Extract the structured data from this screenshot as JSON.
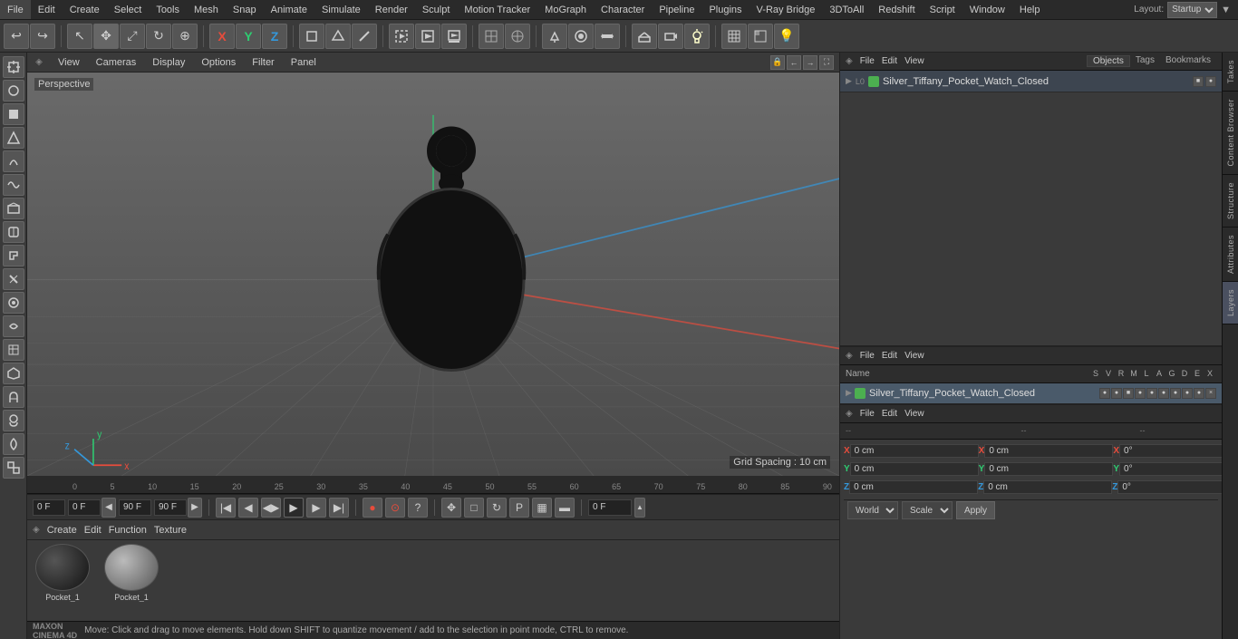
{
  "app": {
    "title": "Cinema 4D",
    "layout": "Startup"
  },
  "menu": {
    "items": [
      "File",
      "Edit",
      "Create",
      "Select",
      "Tools",
      "Mesh",
      "Snap",
      "Animate",
      "Simulate",
      "Render",
      "Sculpt",
      "Motion Tracker",
      "MoGraph",
      "Character",
      "Pipeline",
      "Plugins",
      "V-Ray Bridge",
      "3DToAll",
      "Redshift",
      "Script",
      "Window",
      "Help"
    ]
  },
  "toolbar": {
    "undo_label": "↩",
    "redo_label": "↪"
  },
  "viewport": {
    "label": "Perspective",
    "menu_items": [
      "View",
      "Cameras",
      "Display",
      "Options",
      "Filter",
      "Panel"
    ],
    "grid_spacing": "Grid Spacing : 10 cm"
  },
  "timeline": {
    "start_frame": "0 F",
    "current_frame": "0 F",
    "end_frame": "90 F",
    "max_frame": "90 F",
    "frame_indicator": "0 F",
    "ruler_marks": [
      "0",
      "5",
      "10",
      "15",
      "20",
      "25",
      "30",
      "35",
      "40",
      "45",
      "50",
      "55",
      "60",
      "65",
      "70",
      "75",
      "80",
      "85",
      "90"
    ]
  },
  "objects": {
    "header_cols": [
      "Name",
      "S",
      "V",
      "R",
      "M",
      "L",
      "A",
      "G",
      "D",
      "E",
      "X"
    ],
    "items": [
      {
        "name": "Silver_Tiffany_Pocket_Watch_Closed",
        "color": "#4caf50",
        "visible": true
      }
    ]
  },
  "attributes": {
    "coords": {
      "position": {
        "x": "0 cm",
        "y": "0 cm",
        "z": "0 cm"
      },
      "rotation": {
        "x": "0°",
        "y": "0°",
        "z": "0°"
      },
      "scale": {
        "x": "0 cm",
        "y": "0 cm",
        "z": "0 cm"
      }
    },
    "world_label": "World",
    "scale_label": "Scale",
    "apply_label": "Apply"
  },
  "materials": {
    "items": [
      {
        "name": "Pocket_1",
        "color": "#1a1a1a"
      },
      {
        "name": "Pocket_1",
        "color": "#888"
      }
    ]
  },
  "material_menu": [
    "Create",
    "Edit",
    "Function",
    "Texture"
  ],
  "status_bar": {
    "message": "Move: Click and drag to move elements. Hold down SHIFT to quantize movement / add to the selection in point mode, CTRL to remove."
  },
  "vertical_tabs": [
    "Takes",
    "Content Browser",
    "Structure",
    "Attributes",
    "Layers"
  ],
  "right_top_tabs": [
    "Objects",
    "Tags",
    "Bookmarks"
  ],
  "right_bottom_attr_label": "Name",
  "playback": {
    "record_btn": "●",
    "play_btn": "▶",
    "stop_btn": "■",
    "prev_btn": "◀◀",
    "next_btn": "▶▶",
    "first_btn": "|◀",
    "last_btn": "▶|"
  },
  "icons": {
    "move": "✥",
    "rotate": "↻",
    "scale": "⤢",
    "select": "↖",
    "live_select": "⊕",
    "camera": "📷",
    "light": "💡",
    "cube": "▣",
    "sphere": "○",
    "cylinder": "⬡",
    "spline": "～",
    "nurbs": "∿",
    "deformer": "⊿",
    "tag": "🏷",
    "material": "◈",
    "render": "▶",
    "render_settings": "⚙"
  }
}
